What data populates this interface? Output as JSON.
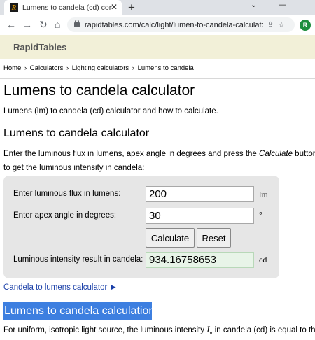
{
  "browser": {
    "tab_title": "Lumens to candela (cd) conversion",
    "tab_close": "✕",
    "new_tab": "+",
    "url": "rapidtables.com/calc/light/lumen-to-candela-calculator...",
    "profile_initial": "R",
    "icons": [
      "back-arrow-icon",
      "forward-arrow-icon",
      "reload-icon",
      "lock-icon",
      "share-icon",
      "star-icon"
    ]
  },
  "site": {
    "logo": "RapidTables",
    "breadcrumb": [
      "Home",
      "›",
      "Calculators",
      "›",
      "Lighting calculators",
      "›",
      "Lumens to candela"
    ]
  },
  "page": {
    "title": "Lumens to candela calculator",
    "intro": "Lumens (lm) to candela (cd) calculator and how to calculate.",
    "section_heading": "Lumens to candela calculator",
    "instruction_part1": "Enter the luminous flux in lumens, apex angle in degrees and press the ",
    "instruction_em": "Calculate",
    "instruction_part2": " button to get the luminous intensity in candela:"
  },
  "calculator": {
    "flux_label": "Enter luminous flux in lumens:",
    "flux_value": "200",
    "flux_unit": "lm",
    "angle_label": "Enter apex angle in degrees:",
    "angle_value": "30",
    "angle_unit": "°",
    "calculate_label": "Calculate",
    "reset_label": "Reset",
    "result_label": "Luminous intensity result in candela:",
    "result_value": "934.16758653",
    "result_unit": "cd"
  },
  "links": {
    "candela_to_lumens": "Candela to lumens calculator ►"
  },
  "calculation_section": {
    "heading": "Lumens to candela calculation",
    "text_part1": "For uniform, isotropic light source, the luminous intensity ",
    "symbol": "I",
    "symbol_sub": "v",
    "text_part2": " in candela (cd) is equal to the"
  },
  "colors": {
    "header_bg": "#f2f0d8",
    "highlight": "#3d7fe0",
    "link": "#1a3fa8",
    "result_bg": "#e8f4e8"
  }
}
